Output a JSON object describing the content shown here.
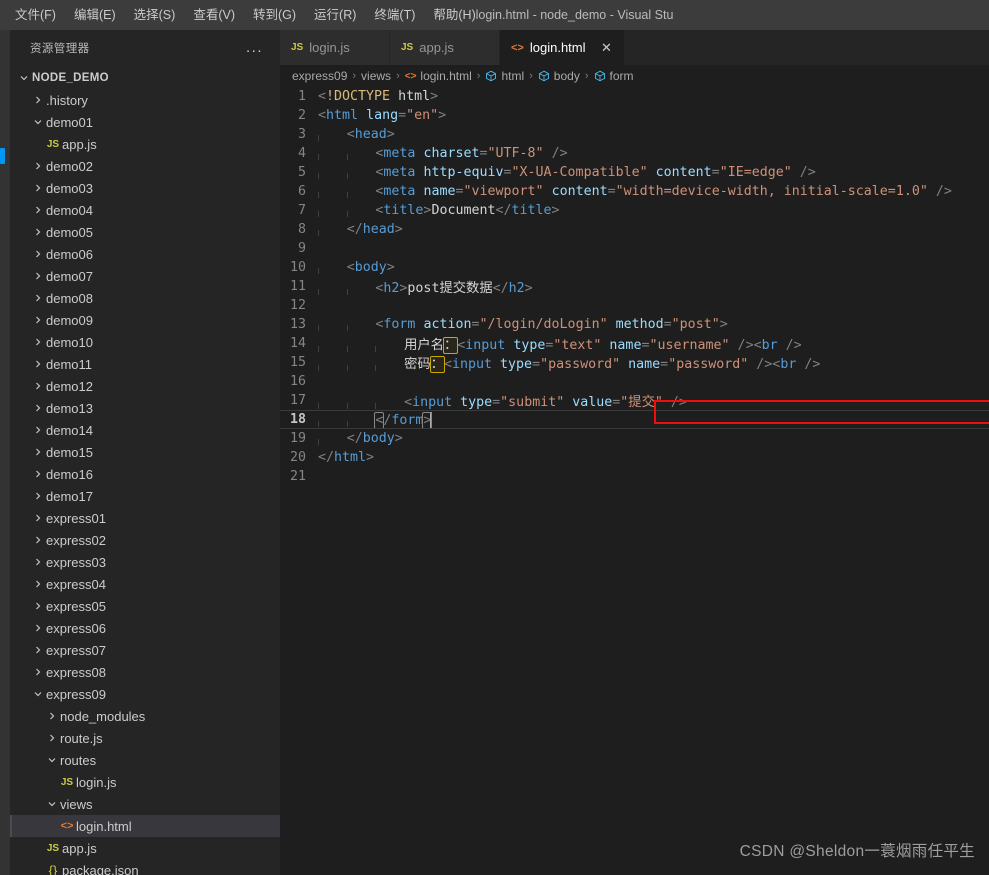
{
  "window": {
    "title": "login.html - node_demo - Visual Stu"
  },
  "menubar": {
    "items": [
      {
        "label": "文件(F)"
      },
      {
        "label": "编辑(E)"
      },
      {
        "label": "选择(S)"
      },
      {
        "label": "查看(V)"
      },
      {
        "label": "转到(G)"
      },
      {
        "label": "运行(R)"
      },
      {
        "label": "终端(T)"
      },
      {
        "label": "帮助(H)"
      }
    ]
  },
  "sidebar": {
    "title": "资源管理器",
    "more_actions": "...",
    "root": "NODE_DEMO",
    "items": [
      {
        "label": ".history",
        "depth": 1,
        "type": "folder",
        "state": "collapsed"
      },
      {
        "label": "demo01",
        "depth": 1,
        "type": "folder",
        "state": "expanded"
      },
      {
        "label": "app.js",
        "depth": 2,
        "type": "js"
      },
      {
        "label": "demo02",
        "depth": 1,
        "type": "folder",
        "state": "collapsed"
      },
      {
        "label": "demo03",
        "depth": 1,
        "type": "folder",
        "state": "collapsed"
      },
      {
        "label": "demo04",
        "depth": 1,
        "type": "folder",
        "state": "collapsed"
      },
      {
        "label": "demo05",
        "depth": 1,
        "type": "folder",
        "state": "collapsed"
      },
      {
        "label": "demo06",
        "depth": 1,
        "type": "folder",
        "state": "collapsed"
      },
      {
        "label": "demo07",
        "depth": 1,
        "type": "folder",
        "state": "collapsed"
      },
      {
        "label": "demo08",
        "depth": 1,
        "type": "folder",
        "state": "collapsed"
      },
      {
        "label": "demo09",
        "depth": 1,
        "type": "folder",
        "state": "collapsed"
      },
      {
        "label": "demo10",
        "depth": 1,
        "type": "folder",
        "state": "collapsed"
      },
      {
        "label": "demo11",
        "depth": 1,
        "type": "folder",
        "state": "collapsed"
      },
      {
        "label": "demo12",
        "depth": 1,
        "type": "folder",
        "state": "collapsed"
      },
      {
        "label": "demo13",
        "depth": 1,
        "type": "folder",
        "state": "collapsed"
      },
      {
        "label": "demo14",
        "depth": 1,
        "type": "folder",
        "state": "collapsed"
      },
      {
        "label": "demo15",
        "depth": 1,
        "type": "folder",
        "state": "collapsed"
      },
      {
        "label": "demo16",
        "depth": 1,
        "type": "folder",
        "state": "collapsed"
      },
      {
        "label": "demo17",
        "depth": 1,
        "type": "folder",
        "state": "collapsed"
      },
      {
        "label": "express01",
        "depth": 1,
        "type": "folder",
        "state": "collapsed"
      },
      {
        "label": "express02",
        "depth": 1,
        "type": "folder",
        "state": "collapsed"
      },
      {
        "label": "express03",
        "depth": 1,
        "type": "folder",
        "state": "collapsed"
      },
      {
        "label": "express04",
        "depth": 1,
        "type": "folder",
        "state": "collapsed"
      },
      {
        "label": "express05",
        "depth": 1,
        "type": "folder",
        "state": "collapsed"
      },
      {
        "label": "express06",
        "depth": 1,
        "type": "folder",
        "state": "collapsed"
      },
      {
        "label": "express07",
        "depth": 1,
        "type": "folder",
        "state": "collapsed"
      },
      {
        "label": "express08",
        "depth": 1,
        "type": "folder",
        "state": "collapsed"
      },
      {
        "label": "express09",
        "depth": 1,
        "type": "folder",
        "state": "expanded"
      },
      {
        "label": "node_modules",
        "depth": 2,
        "type": "folder",
        "state": "collapsed"
      },
      {
        "label": "route.js",
        "depth": 2,
        "type": "folder",
        "state": "collapsed"
      },
      {
        "label": "routes",
        "depth": 2,
        "type": "folder",
        "state": "expanded"
      },
      {
        "label": "login.js",
        "depth": 3,
        "type": "js"
      },
      {
        "label": "views",
        "depth": 2,
        "type": "folder",
        "state": "expanded"
      },
      {
        "label": "login.html",
        "depth": 3,
        "type": "html",
        "selected": true
      },
      {
        "label": "app.js",
        "depth": 2,
        "type": "js"
      },
      {
        "label": "package.json",
        "depth": 2,
        "type": "json"
      }
    ]
  },
  "tabs": [
    {
      "label": "login.js",
      "icon": "js-file-icon",
      "active": false
    },
    {
      "label": "app.js",
      "icon": "js-file-icon",
      "active": false
    },
    {
      "label": "login.html",
      "icon": "html-file-icon",
      "active": true,
      "close": "✕"
    }
  ],
  "breadcrumb": {
    "separator": "›",
    "items": [
      {
        "label": "express09",
        "icon": "none"
      },
      {
        "label": "views",
        "icon": "none"
      },
      {
        "label": "login.html",
        "icon": "html-file-icon"
      },
      {
        "label": "html",
        "icon": "symbol-field-icon"
      },
      {
        "label": "body",
        "icon": "symbol-field-icon"
      },
      {
        "label": "form",
        "icon": "symbol-field-icon"
      }
    ]
  },
  "editor": {
    "language": "html",
    "current_line": 18,
    "total_lines": 21,
    "lines": [
      {
        "n": 1,
        "raw": "<!DOCTYPE html>"
      },
      {
        "n": 2,
        "raw": "<html lang=\"en\">"
      },
      {
        "n": 3,
        "raw": "  <head>"
      },
      {
        "n": 4,
        "raw": "    <meta charset=\"UTF-8\" />"
      },
      {
        "n": 5,
        "raw": "    <meta http-equiv=\"X-UA-Compatible\" content=\"IE=edge\" />"
      },
      {
        "n": 6,
        "raw": "    <meta name=\"viewport\" content=\"width=device-width, initial-scale=1.0\" />"
      },
      {
        "n": 7,
        "raw": "    <title>Document</title>"
      },
      {
        "n": 8,
        "raw": "  </head>"
      },
      {
        "n": 9,
        "raw": ""
      },
      {
        "n": 10,
        "raw": "  <body>"
      },
      {
        "n": 11,
        "raw": "    <h2>post提交数据</h2>"
      },
      {
        "n": 12,
        "raw": ""
      },
      {
        "n": 13,
        "raw": "    <form action=\"/login/doLogin\" method=\"post\">"
      },
      {
        "n": 14,
        "raw": "      用户名：<input type=\"text\" name=\"username\" /><br />"
      },
      {
        "n": 15,
        "raw": "      密码：<input type=\"password\" name=\"password\" /><br />"
      },
      {
        "n": 16,
        "raw": ""
      },
      {
        "n": 17,
        "raw": "      <input type=\"submit\" value=\"提交\" />"
      },
      {
        "n": 18,
        "raw": "    </form>"
      },
      {
        "n": 19,
        "raw": "  </body>"
      },
      {
        "n": 20,
        "raw": "</html>"
      },
      {
        "n": 21,
        "raw": ""
      }
    ]
  },
  "annotation": {
    "type": "rectangle",
    "color": "#f20d0d",
    "target_line": 13,
    "target_text": "<form action=\"/login/doLogin\" method=\"post\">"
  },
  "watermark": {
    "text": "CSDN @Sheldon一蓑烟雨任平生"
  },
  "colors": {
    "titlebar_bg": "#3c3c3c",
    "sidebar_bg": "#252526",
    "editor_bg": "#1e1e1e",
    "tab_active_bg": "#1e1e1e",
    "tab_inactive_bg": "#2d2d2d",
    "selection_bg": "#37373d",
    "tag": "#569cd6",
    "attribute": "#9cdcfe",
    "string": "#ce9178",
    "punctuation": "#808080",
    "linenumber": "#858585",
    "annotation_red": "#f20d0d",
    "unusual_char_outline": "#cca700",
    "activity_badge": "#0097fb"
  }
}
